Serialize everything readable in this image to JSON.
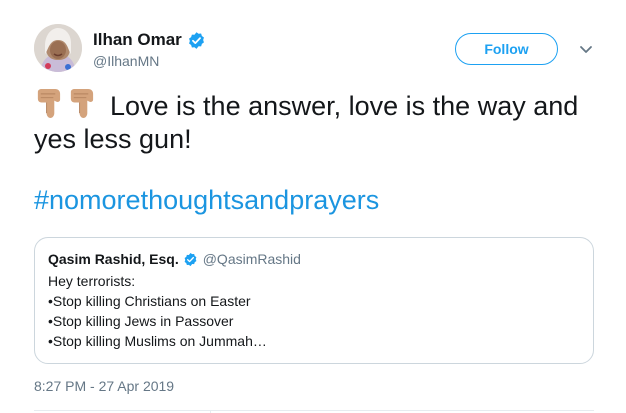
{
  "author": {
    "name": "Ilhan Omar",
    "handle": "@IlhanMN"
  },
  "follow_label": "Follow",
  "tweet": {
    "emoji": [
      "backhand-index-pointing-down",
      "backhand-index-pointing-down"
    ],
    "text": "Love is the answer, love is the way and yes less gun!",
    "hashtag": "#nomorethoughtsandprayers",
    "timestamp": "8:27 PM - 27 Apr 2019"
  },
  "quoted_tweet": {
    "name": "Qasim Rashid, Esq.",
    "handle": "@QasimRashid",
    "lines": [
      "Hey terrorists:",
      "•Stop killing Christians on Easter",
      "•Stop killing Jews in Passover",
      "•Stop killing Muslims on Jummah…"
    ]
  },
  "colors": {
    "accent": "#1da1f2",
    "hashtag": "#1b95e0",
    "muted": "#657786",
    "border": "#ccd6dd",
    "emoji_skin": "#d4a37c"
  }
}
